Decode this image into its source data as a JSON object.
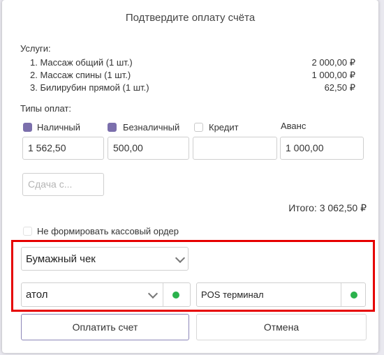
{
  "dialog": {
    "title": "Подтвердите оплату счёта"
  },
  "services": {
    "label": "Услуги:",
    "items": [
      {
        "name": "1. Массаж общий (1 шт.)",
        "price": "2 000,00 ₽"
      },
      {
        "name": "2. Массаж спины (1 шт.)",
        "price": "1 000,00 ₽"
      },
      {
        "name": "3. Билирубин прямой (1 шт.)",
        "price": "62,50 ₽"
      }
    ]
  },
  "payment_types": {
    "label": "Типы оплат:",
    "cash": {
      "label": "Наличный",
      "checked": true,
      "value": "1 562,50"
    },
    "cashless": {
      "label": "Безналичный",
      "checked": true,
      "value": "500,00"
    },
    "credit": {
      "label": "Кредит",
      "checked": false,
      "value": ""
    },
    "advance": {
      "label": "Аванс",
      "value": "1 000,00"
    }
  },
  "change": {
    "placeholder": "Сдача с..."
  },
  "total": {
    "text": "Итого: 3 062,50 ₽"
  },
  "no_cash_order": {
    "label": "Не формировать кассовый ордер",
    "checked": false
  },
  "receipt_type": {
    "value": "Бумажный чек"
  },
  "cash_register": {
    "value": "атол",
    "status_color": "#2bb24c"
  },
  "pos_terminal": {
    "label": "POS терминал",
    "status_color": "#2bb24c"
  },
  "buttons": {
    "pay": "Оплатить счет",
    "cancel": "Отмена"
  }
}
